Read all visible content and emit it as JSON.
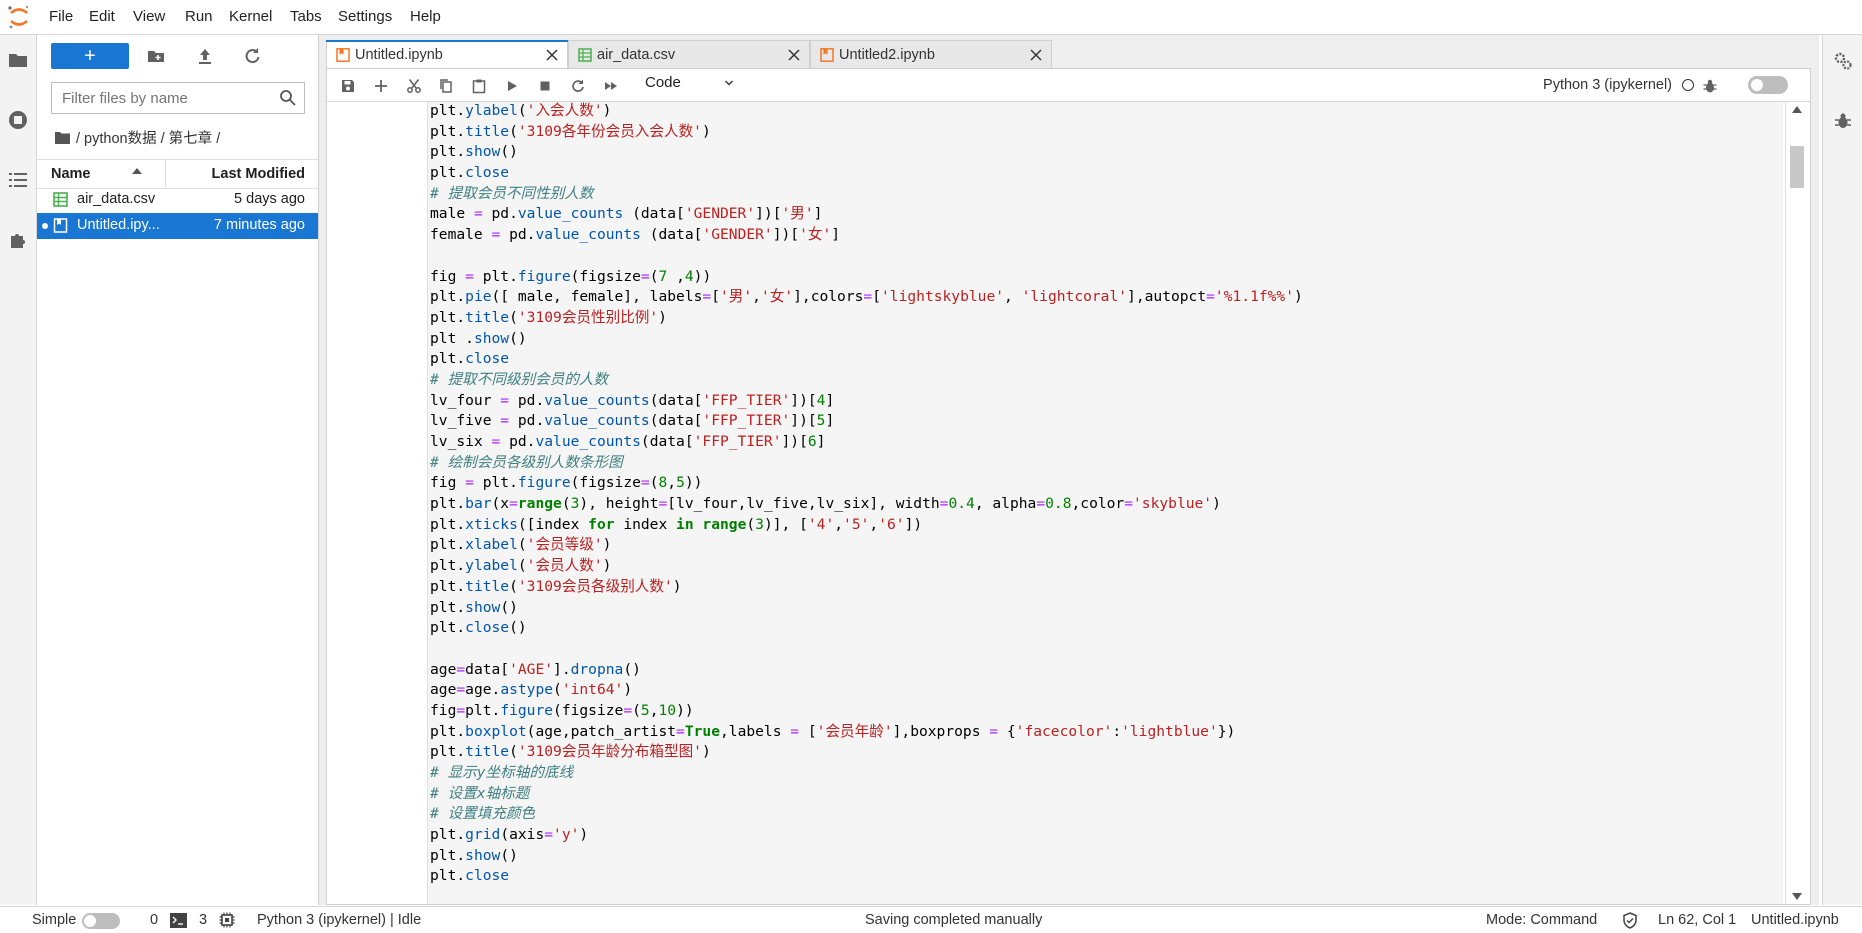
{
  "menubar": {
    "items": [
      "File",
      "Edit",
      "View",
      "Run",
      "Kernel",
      "Tabs",
      "Settings",
      "Help"
    ]
  },
  "filebrowser": {
    "new_label": "+",
    "filter_placeholder": "Filter files by name",
    "breadcrumb": "/ python数据 / 第七章 /",
    "columns": {
      "name": "Name",
      "modified": "Last Modified"
    },
    "files": [
      {
        "name": "air_data.csv",
        "modified": "5 days ago",
        "icon": "spreadsheet-icon"
      },
      {
        "name": "Untitled.ipy...",
        "modified": "7 minutes ago",
        "icon": "notebook-icon"
      }
    ]
  },
  "tabs": [
    {
      "label": "Untitled.ipynb",
      "icon": "notebook-icon",
      "active": true
    },
    {
      "label": "air_data.csv",
      "icon": "spreadsheet-icon",
      "active": false
    },
    {
      "label": "Untitled2.ipynb",
      "icon": "notebook-icon",
      "active": false
    }
  ],
  "toolbar": {
    "cell_type": "Code",
    "kernel_name": "Python 3 (ipykernel)"
  },
  "code_lines": [
    "plt.ylabel('入会人数')",
    "plt.title('3109各年份会员入会人数')",
    "plt.show()",
    "plt.close",
    "# 提取会员不同性别人数",
    "male = pd.value_counts (data['GENDER'])['男']",
    "female = pd.value_counts (data['GENDER'])['女']",
    "",
    "fig = plt.figure(figsize=(7 ,4))",
    "plt.pie([ male, female], labels=['男','女'],colors=['lightskyblue', 'lightcoral'],autopct='%1.1f%%')",
    "plt.title('3109会员性别比例')",
    "plt .show()",
    "plt.close",
    "# 提取不同级别会员的人数",
    "lv_four = pd.value_counts(data['FFP_TIER'])[4]",
    "lv_five = pd.value_counts(data['FFP_TIER'])[5]",
    "lv_six = pd.value_counts(data['FFP_TIER'])[6]",
    "# 绘制会员各级别人数条形图",
    "fig = plt.figure(figsize=(8,5))",
    "plt.bar(x=range(3), height=[lv_four,lv_five,lv_six], width=0.4, alpha=0.8,color='skyblue')",
    "plt.xticks([index for index in range(3)], ['4','5','6'])",
    "plt.xlabel('会员等级')",
    "plt.ylabel('会员人数')",
    "plt.title('3109会员各级别人数')",
    "plt.show()",
    "plt.close()",
    "",
    "age=data['AGE'].dropna()",
    "age=age.astype('int64')",
    "fig=plt.figure(figsize=(5,10))",
    "plt.boxplot(age,patch_artist=True,labels = ['会员年龄'],boxprops = {'facecolor':'lightblue'})",
    "plt.title('3109会员年龄分布箱型图')",
    "# 显示y坐标轴的底线",
    "# 设置x轴标题",
    "# 设置填充颜色",
    "plt.grid(axis='y')",
    "plt.show()",
    "plt.close"
  ],
  "statusbar": {
    "simple_label": "Simple",
    "terminals_count": "0",
    "kernels_count": "3",
    "kernel_status": "Python 3 (ipykernel) | Idle",
    "message": "Saving completed manually",
    "mode": "Mode: Command",
    "cursor": "Ln 62, Col 1",
    "filename": "Untitled.ipynb"
  },
  "colors": {
    "accent": "#1976d2",
    "notebook_icon": "#f37726",
    "csv_icon": "#4caf50"
  }
}
